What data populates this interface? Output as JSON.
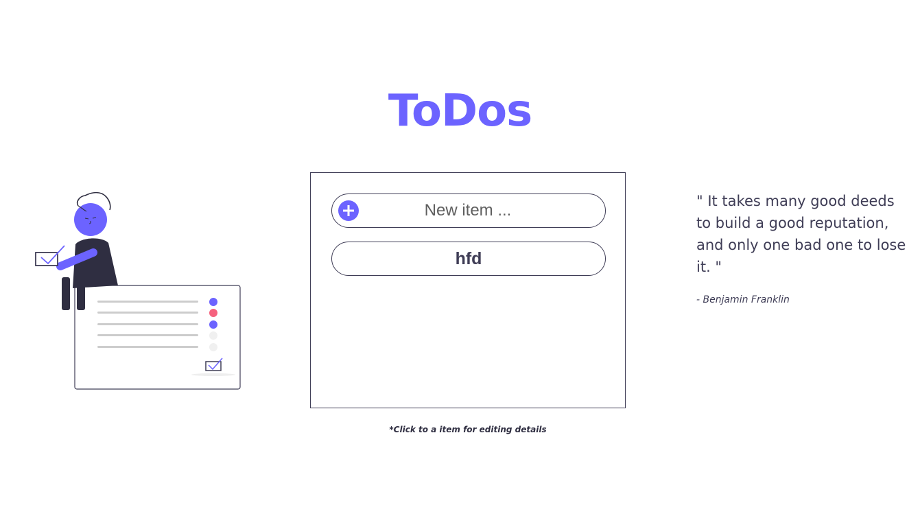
{
  "header": {
    "title": "ToDos"
  },
  "new_item": {
    "placeholder": "New item ...",
    "add_icon": "plus-icon"
  },
  "todos": [
    {
      "label": "hfd"
    }
  ],
  "hint": "*Click to a item for editing details",
  "quote": {
    "text": "\" It takes many good deeds to build a good reputation, and only one bad one to lose it. \"",
    "author": "- Benjamin Franklin"
  },
  "colors": {
    "accent": "#6c63ff",
    "dark": "#3f3d56",
    "pink": "#f5627e",
    "gray_line": "#cccccc"
  }
}
